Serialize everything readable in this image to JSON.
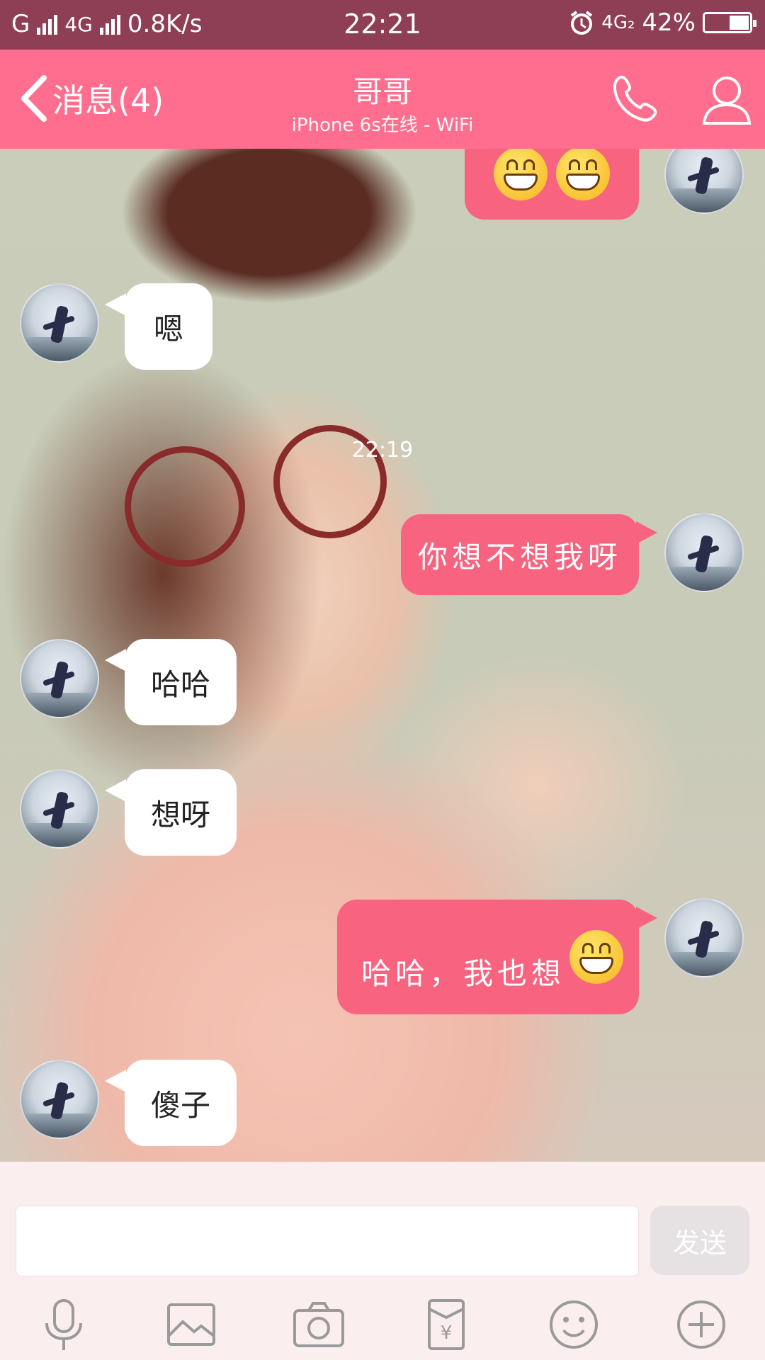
{
  "status_bar": {
    "network_left": "G",
    "network_mid": "4G",
    "speed": "0.8K/s",
    "time": "22:21",
    "network_right": "4G₂",
    "battery_percent": "42%",
    "battery_level": 0.42
  },
  "nav": {
    "back_label": "消息(4)",
    "title": "哥哥",
    "subtitle": "iPhone 6s在线 - WiFi",
    "icons": [
      "phone-icon",
      "profile-icon"
    ]
  },
  "chat": {
    "timestamp": "22:19",
    "messages": [
      {
        "side": "out",
        "text": "",
        "emoji_count": 2
      },
      {
        "side": "in",
        "text": "嗯"
      },
      {
        "side": "out",
        "text": "你想不想我呀"
      },
      {
        "side": "in",
        "text": "哈哈"
      },
      {
        "side": "in",
        "text": "想呀"
      },
      {
        "side": "out",
        "text": "哈哈，我也想",
        "emoji_count": 1
      },
      {
        "side": "in",
        "text": "傻子"
      }
    ]
  },
  "input": {
    "placeholder": "",
    "send_label": "发送"
  },
  "toolbar": {
    "icons": [
      "microphone-icon",
      "image-icon",
      "camera-icon",
      "red-packet-icon",
      "emoji-icon",
      "plus-icon"
    ],
    "packet_symbol": "¥"
  },
  "colors": {
    "status_bar": "#8e3e55",
    "accent_pink": "#ff6e8e",
    "bubble_out": "#f8647f",
    "bubble_in": "#ffffff"
  }
}
